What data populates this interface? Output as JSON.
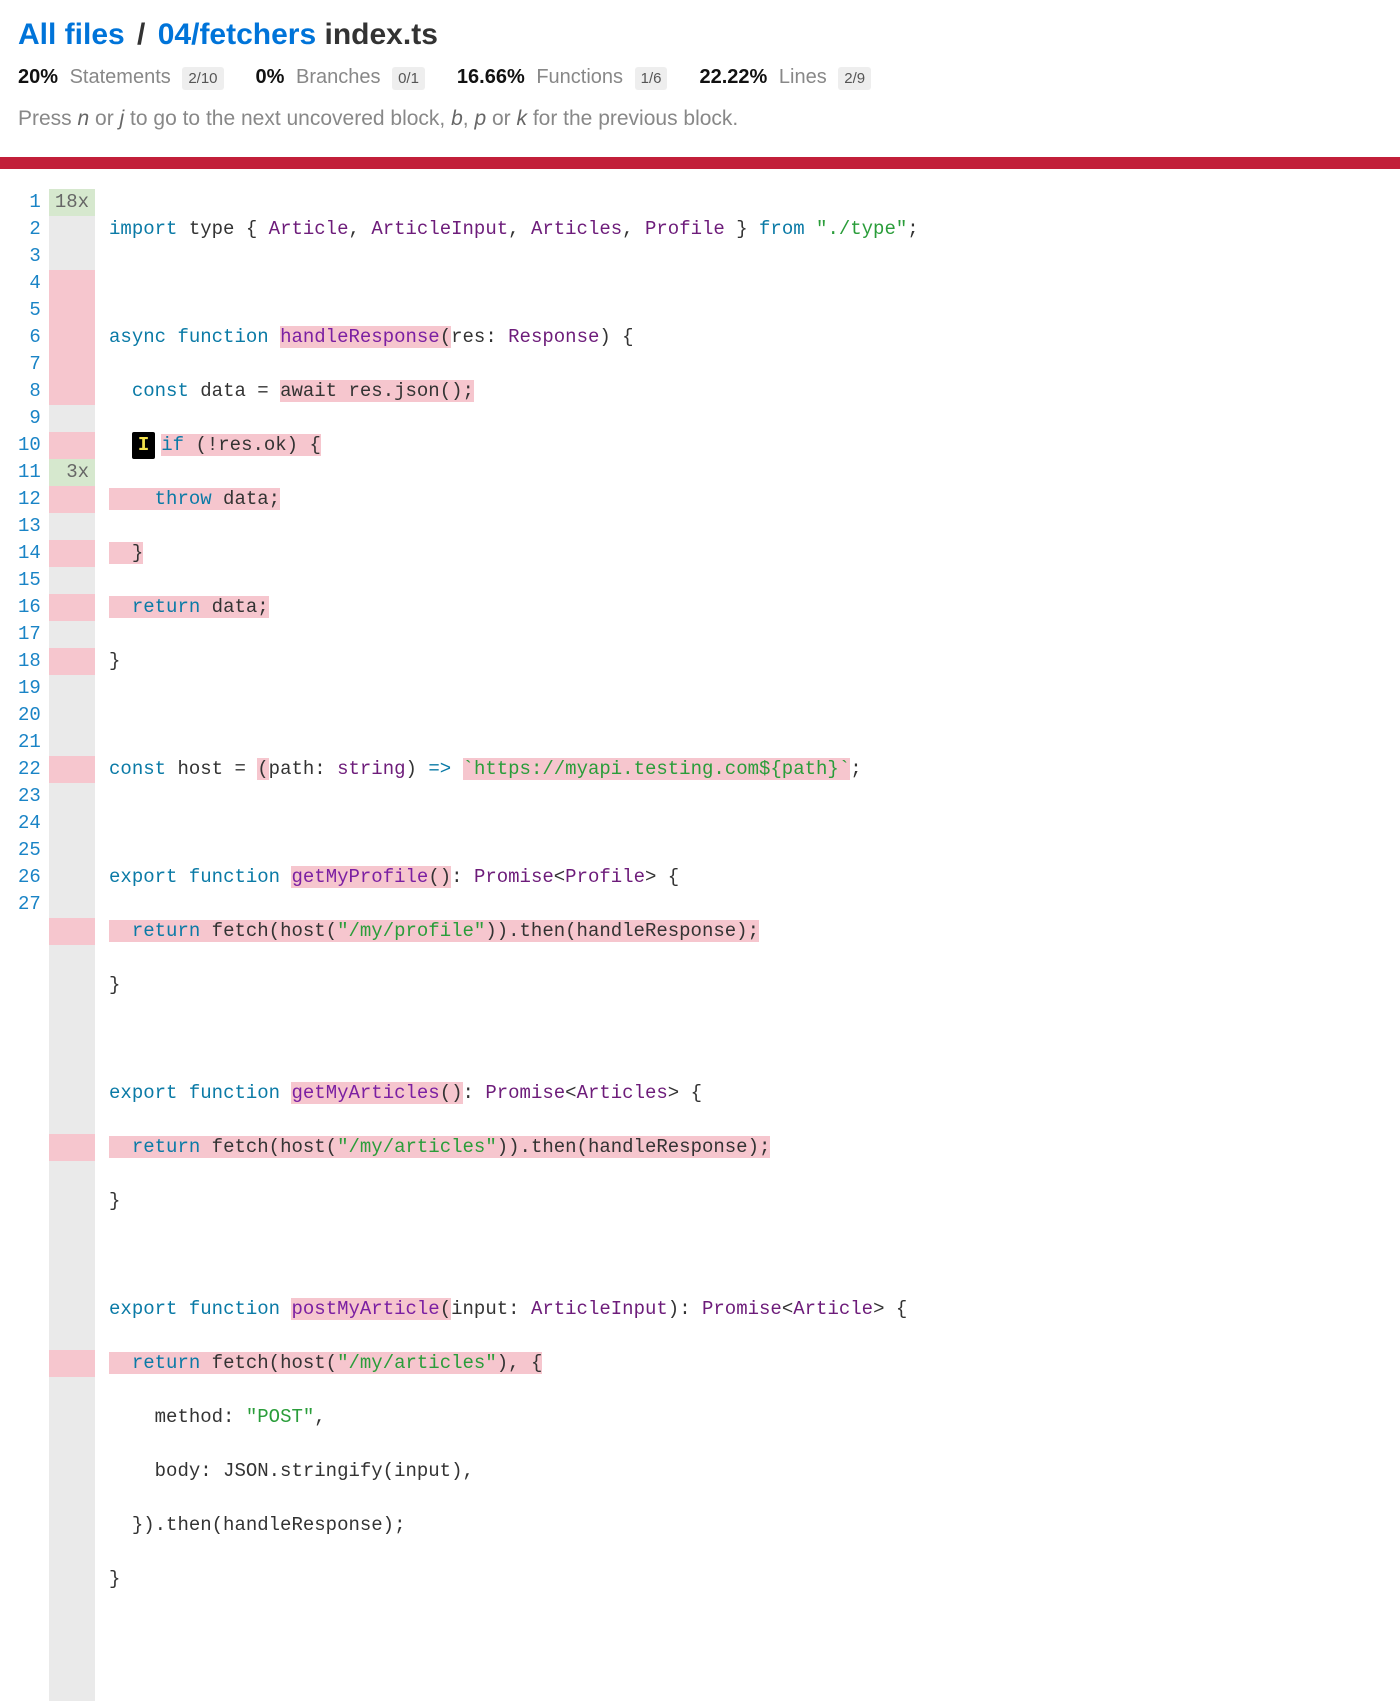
{
  "breadcrumb": {
    "root": "All files",
    "path": "04/fetchers",
    "file": "index.ts"
  },
  "stats": {
    "statements": {
      "pct": "20%",
      "label": "Statements",
      "frac": "2/10"
    },
    "branches": {
      "pct": "0%",
      "label": "Branches",
      "frac": "0/1"
    },
    "functions": {
      "pct": "16.66%",
      "label": "Functions",
      "frac": "1/6"
    },
    "lines": {
      "pct": "22.22%",
      "label": "Lines",
      "frac": "2/9"
    }
  },
  "hint": {
    "prefix": "Press ",
    "k1": "n",
    "or1": " or ",
    "k2": "j",
    "mid": " to go to the next uncovered block, ",
    "k3": "b",
    "comma": ", ",
    "k4": "p",
    "or2": " or ",
    "k5": "k",
    "suffix": " for the previous block."
  },
  "line_count": 27,
  "coverage_counts": {
    "1": "18x",
    "11": "3x"
  },
  "miss_gutter_lines": [
    4,
    5,
    6,
    7,
    8,
    14,
    18,
    22
  ],
  "branch_marker": "I",
  "code": {
    "l1": {
      "a": "import",
      "b": " type { ",
      "c": "Article",
      "d": ", ",
      "e": "ArticleInput",
      "f": ", ",
      "g": "Articles",
      "h": ", ",
      "i": "Profile",
      "j": " } ",
      "k": "from",
      "l": " ",
      "m": "\"./type\"",
      "n": ";"
    },
    "l3": {
      "a": "async",
      "b": " ",
      "c": "function",
      "d": " ",
      "fn": "handleResponse",
      "e": "(",
      "p": "res",
      "f": ": ",
      "ty": "Response",
      "g": ") {"
    },
    "l4": {
      "a": "  ",
      "b": "const",
      "c": " data = ",
      "d": "await res.json();"
    },
    "l5": {
      "a": "if",
      "b": " (!res.ok) {"
    },
    "l6": {
      "a": "    ",
      "b": "throw",
      "c": " data;"
    },
    "l7": {
      "a": "  }"
    },
    "l8": {
      "a": "  ",
      "b": "return",
      "c": " data;"
    },
    "l9": {
      "a": "}"
    },
    "l11": {
      "a": "const",
      "b": " host = ",
      "c": "(",
      "d": "path",
      "e": ": ",
      "f": "string",
      "g": ") ",
      "h": "=>",
      "i": " ",
      "j": "`https://myapi.testing.com${path}`",
      "k": ";"
    },
    "l13": {
      "a": "export",
      "b": " ",
      "c": "function",
      "d": " ",
      "fn": "getMyProfile",
      "e": "()",
      "f": ": ",
      "g": "Promise",
      "h": "<",
      "i": "Profile",
      "j": "> {"
    },
    "l14": {
      "a": "  ",
      "b": "return",
      "c": " fetch(host(",
      "d": "\"/my/profile\"",
      "e": ")).then(handleResponse);"
    },
    "l15": {
      "a": "}"
    },
    "l17": {
      "a": "export",
      "b": " ",
      "c": "function",
      "d": " ",
      "fn": "getMyArticles",
      "e": "()",
      "f": ": ",
      "g": "Promise",
      "h": "<",
      "i": "Articles",
      "j": "> {"
    },
    "l18": {
      "a": "  ",
      "b": "return",
      "c": " fetch(host(",
      "d": "\"/my/articles\"",
      "e": ")).then(handleResponse);"
    },
    "l19": {
      "a": "}"
    },
    "l21": {
      "a": "export",
      "b": " ",
      "c": "function",
      "d": " ",
      "fn": "postMyArticle",
      "e": "(",
      "p": "input",
      "f": ": ",
      "ty": "ArticleInput",
      "g": ")",
      "h": ": ",
      "i": "Promise",
      "j": "<",
      "k": "Article",
      "l": "> {"
    },
    "l22": {
      "a": "  ",
      "b": "return",
      "c": " fetch(host(",
      "d": "\"/my/articles\"",
      "e": "), {"
    },
    "l23": {
      "a": "    method: ",
      "b": "\"POST\"",
      "c": ","
    },
    "l24": {
      "a": "    body: JSON.stringify(input),"
    },
    "l25": {
      "a": "  }).then(handleResponse);"
    },
    "l26": {
      "a": "}"
    }
  }
}
